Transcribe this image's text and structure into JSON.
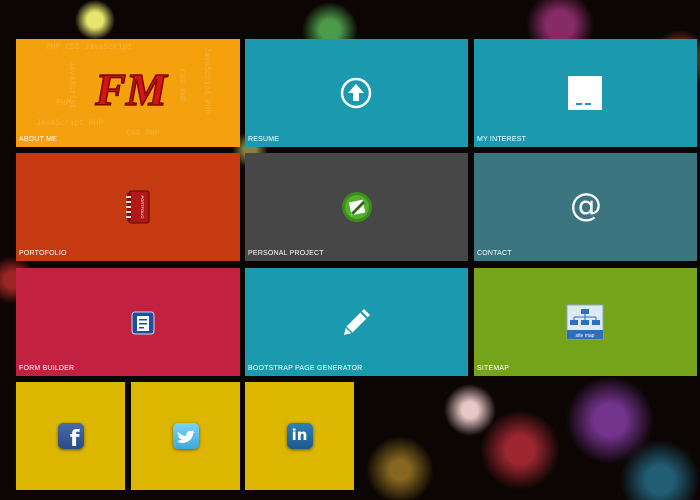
{
  "tiles": {
    "about": {
      "label": "ABOUT ME",
      "logo": "FM",
      "color": "#f5a10e"
    },
    "resume": {
      "label": "RESUME",
      "icon": "upload-arrow-icon",
      "color": "#1b9aaf"
    },
    "interest": {
      "label": "MY INTEREST",
      "icon": "window-icon",
      "color": "#1b9aaf"
    },
    "portfolio": {
      "label": "PORTOFOLIO",
      "icon": "portfolio-book-icon",
      "icon_text": "PORTFOLIO",
      "color": "#c63a12"
    },
    "personal": {
      "label": "PERSONAL PROJECT",
      "icon": "project-icon",
      "color": "#474747"
    },
    "contact": {
      "label": "CONTACT",
      "icon": "at-sign-icon",
      "glyph": "@",
      "color": "#3b7680"
    },
    "form": {
      "label": "FORM BUILDER",
      "icon": "form-icon",
      "color": "#c2213f"
    },
    "bootstrap": {
      "label": "BOOTSTRAP PAGE GENERATOR",
      "icon": "pencil-icon",
      "color": "#1b9aaf"
    },
    "sitemap": {
      "label": "SITEMAP",
      "icon": "sitemap-icon",
      "icon_text": "site map",
      "color": "#75a31a"
    },
    "facebook": {
      "icon": "facebook-icon",
      "glyph": "f",
      "color": "#dcb600"
    },
    "twitter": {
      "icon": "twitter-icon",
      "color": "#dcb600"
    },
    "linkedin": {
      "icon": "linkedin-icon",
      "glyph": "in",
      "color": "#dcb600"
    }
  }
}
